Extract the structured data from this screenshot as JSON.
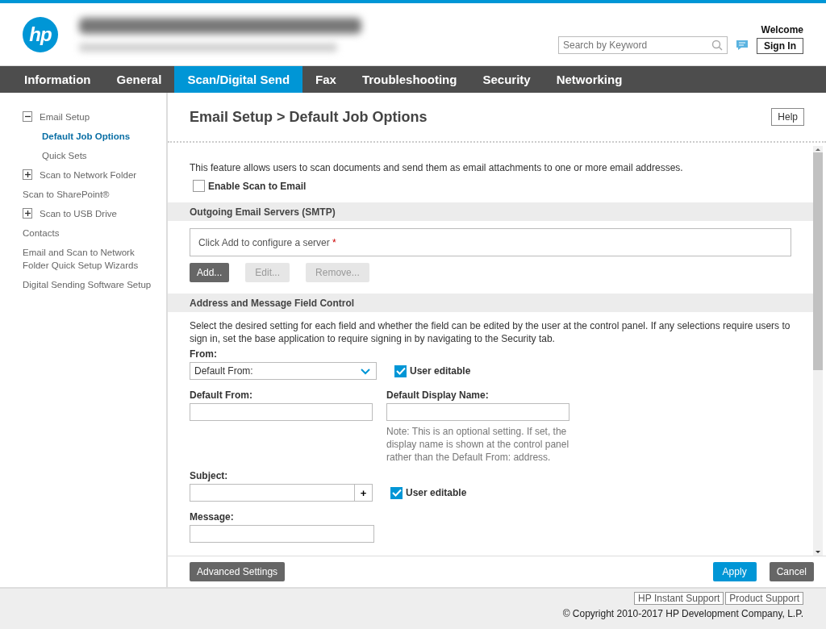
{
  "header": {
    "logo": "hp",
    "search": {
      "placeholder": "Search by Keyword"
    },
    "welcome": "Welcome",
    "sign_in": "Sign In"
  },
  "tabs": [
    {
      "label": "Information",
      "selected": false
    },
    {
      "label": "General",
      "selected": false
    },
    {
      "label": "Scan/Digital Send",
      "selected": true
    },
    {
      "label": "Fax",
      "selected": false
    },
    {
      "label": "Troubleshooting",
      "selected": false
    },
    {
      "label": "Security",
      "selected": false
    },
    {
      "label": "Networking",
      "selected": false
    }
  ],
  "sidebar": {
    "items": [
      {
        "label": "Email Setup",
        "expanded": true,
        "selected": false,
        "children": [
          {
            "label": "Default Job Options",
            "selected": true
          },
          {
            "label": "Quick Sets",
            "selected": false
          }
        ]
      },
      {
        "label": "Scan to Network Folder",
        "expanded": false,
        "selected": false
      },
      {
        "label": "Scan to SharePoint®",
        "selected": false
      },
      {
        "label": "Scan to USB Drive",
        "expanded": false,
        "selected": false
      },
      {
        "label": "Contacts",
        "selected": false
      },
      {
        "label": "Email and Scan to Network Folder Quick Setup Wizards",
        "selected": false
      },
      {
        "label": "Digital Sending Software Setup",
        "selected": false
      }
    ]
  },
  "page": {
    "title": "Email Setup > Default Job Options",
    "help": "Help",
    "intro": "This feature allows users to scan documents and send them as email attachments to one or more email addresses.",
    "enable": {
      "label": "Enable Scan to Email",
      "checked": false
    },
    "smtp": {
      "heading": "Outgoing Email Servers (SMTP)",
      "placeholder": "Click Add to configure a server",
      "required_mark": "*",
      "buttons": [
        {
          "label": "Add...",
          "disabled": false
        },
        {
          "label": "Edit...",
          "disabled": true
        },
        {
          "label": "Remove...",
          "disabled": true
        }
      ]
    },
    "address": {
      "heading": "Address and Message Field Control",
      "description": "Select the desired setting for each field and whether the field can be edited by the user at the control panel. If any selections require users to sign in, set the base application to require signing in by navigating to the Security tab.",
      "from_label": "From:",
      "from_value": "Default From:",
      "from_editable": {
        "label": "User editable",
        "checked": true
      },
      "default_from_label": "Default From:",
      "display_name_label": "Default Display Name:",
      "display_name_note": "Note: This is an optional setting. If set, the display name is shown at the control panel rather than the Default From: address.",
      "subject_label": "Subject:",
      "subject_add": "+",
      "subject_editable": {
        "label": "User editable",
        "checked": true
      },
      "message_label": "Message:"
    }
  },
  "actions": {
    "advanced": "Advanced Settings",
    "apply": "Apply",
    "cancel": "Cancel"
  },
  "footer": {
    "links": [
      "HP Instant Support",
      "Product Support"
    ],
    "copyright": "© Copyright 2010-2017 HP Development Company, L.P."
  }
}
